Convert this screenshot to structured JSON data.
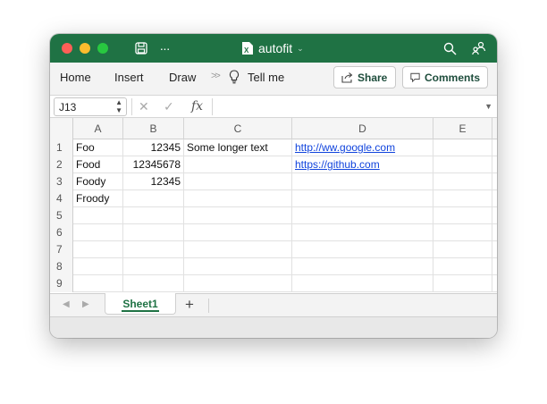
{
  "window": {
    "title": "autofit"
  },
  "titlebar": {
    "icons": [
      "save-icon",
      "more-icon",
      "excel-file-icon",
      "search-icon",
      "share-people-icon"
    ],
    "more_label": "···"
  },
  "ribbon": {
    "tabs": [
      "Home",
      "Insert",
      "Draw"
    ],
    "overflow": ">>",
    "tell_me": "Tell me",
    "share_label": "Share",
    "comments_label": "Comments"
  },
  "formula_bar": {
    "name_box": "J13",
    "cancel_glyph": "✕",
    "confirm_glyph": "✓",
    "fx_label": "fx",
    "formula": ""
  },
  "grid": {
    "columns": [
      "A",
      "B",
      "C",
      "D",
      "E"
    ],
    "rows": [
      {
        "num": "1",
        "A": "Foo",
        "B": "12345",
        "C": "Some longer text",
        "D": "http://ww.google.com"
      },
      {
        "num": "2",
        "A": "Food",
        "B": "12345678",
        "C": "",
        "D": "https://github.com"
      },
      {
        "num": "3",
        "A": "Foody",
        "B": "12345",
        "C": "",
        "D": ""
      },
      {
        "num": "4",
        "A": "Froody",
        "B": "",
        "C": "",
        "D": ""
      },
      {
        "num": "5",
        "A": "",
        "B": "",
        "C": "",
        "D": ""
      },
      {
        "num": "6",
        "A": "",
        "B": "",
        "C": "",
        "D": ""
      },
      {
        "num": "7",
        "A": "",
        "B": "",
        "C": "",
        "D": ""
      },
      {
        "num": "8",
        "A": "",
        "B": "",
        "C": "",
        "D": ""
      },
      {
        "num": "9",
        "A": "",
        "B": "",
        "C": "",
        "D": ""
      }
    ]
  },
  "sheets": {
    "tabs": [
      "Sheet1"
    ],
    "add_label": "+"
  },
  "colors": {
    "title_bar": "#1f7244",
    "link": "#1144dd",
    "active_tab": "#1f7244"
  }
}
